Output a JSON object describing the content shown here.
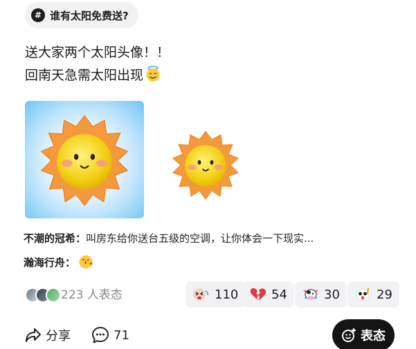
{
  "topic": {
    "label": "谁有太阳免费送?",
    "icon": "hashtag-icon"
  },
  "post": {
    "line1": "送大家两个太阳头像！！",
    "line2": "回南天急需太阳出现",
    "emoji": "smiling-face-with-halo-emoji"
  },
  "images": [
    {
      "name": "sun-avatar-blue-glow",
      "background": "#9fd7f8"
    },
    {
      "name": "sun-avatar-plain",
      "background": "#ffffff"
    }
  ],
  "comments": [
    {
      "user": "不潮的冠希：",
      "text": "叫房东给你送台五级的空调，让你体会一下现实..."
    },
    {
      "user": "瀚海行舟：",
      "text": "",
      "emoji": "kissing-face-emoji"
    }
  ],
  "reactions_summary": {
    "count_text": "223 人表态"
  },
  "reactions": [
    {
      "icon": "laughing-tears-emoji",
      "count": "110"
    },
    {
      "icon": "broken-heart-emoji",
      "count": "54"
    },
    {
      "icon": "cow-emoji",
      "count": "30"
    },
    {
      "icon": "shocked-face-emoji",
      "count": "29"
    }
  ],
  "actions": {
    "share_label": "分享",
    "comment_count": "71",
    "express_label": "表态"
  },
  "colors": {
    "pill_bg": "#f2f2f4",
    "express_bg": "#141414",
    "muted_text": "#8a8a8a",
    "sun_orange": "#f59a3c",
    "sun_yellow": "#f2d21e"
  }
}
